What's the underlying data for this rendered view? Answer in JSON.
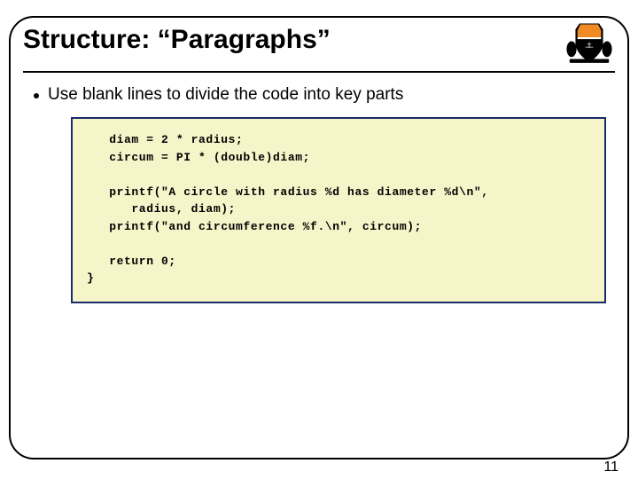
{
  "slide": {
    "title": "Structure: “Paragraphs”",
    "bullet": "Use blank lines to divide the code into key parts",
    "page_number": "11"
  },
  "crest": {
    "name": "princeton-shield-icon"
  },
  "code": {
    "content": "   diam = 2 * radius;\n   circum = PI * (double)diam;\n\n   printf(\"A circle with radius %d has diameter %d\\n\",\n      radius, diam);\n   printf(\"and circumference %f.\\n\", circum);\n\n   return 0;\n}"
  }
}
